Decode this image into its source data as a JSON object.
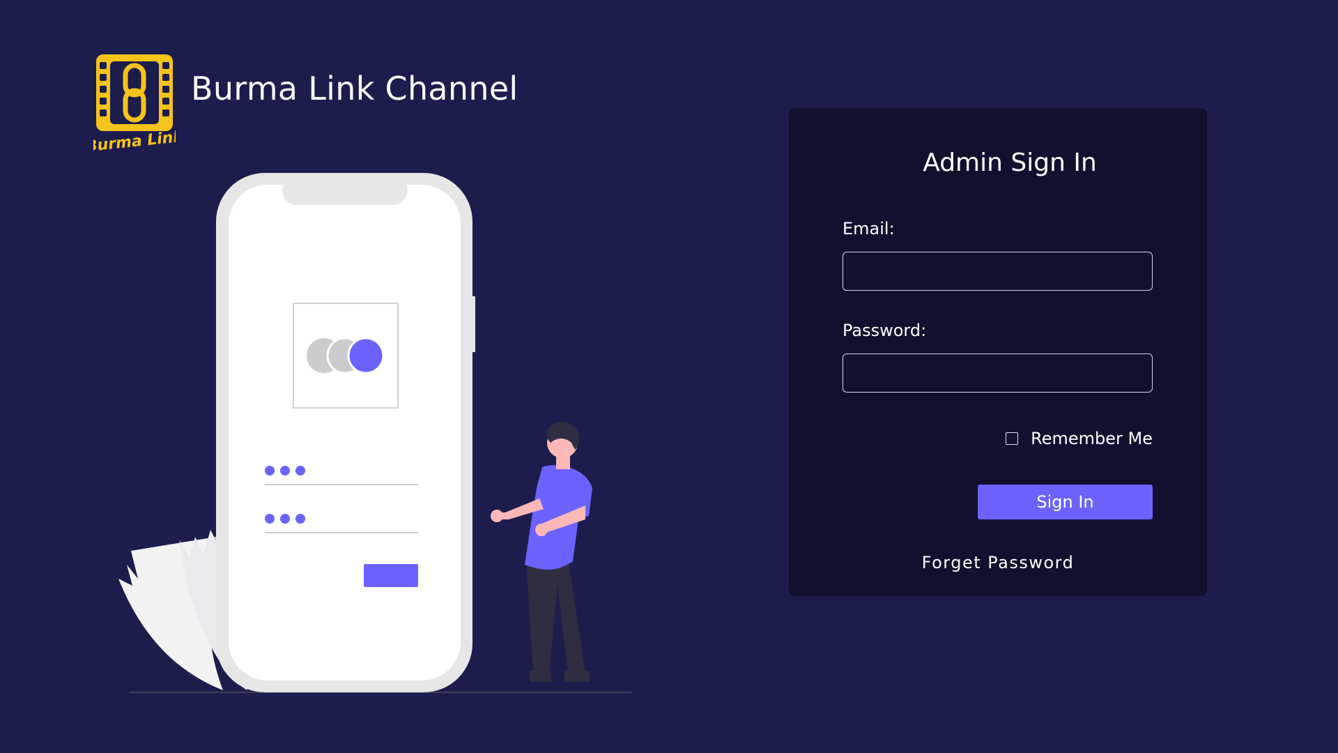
{
  "brand": {
    "logo_text": "Burma Link",
    "title": "Burma Link Channel"
  },
  "colors": {
    "background": "#1c1d4d",
    "card": "#11112f",
    "accent": "#6c63ff",
    "logo_yellow": "#f6c31b"
  },
  "illustration": {
    "icons": [
      "phone-illustration",
      "person-illustration",
      "leaf-illustration"
    ]
  },
  "signin": {
    "title": "Admin Sign In",
    "email_label": "Email:",
    "email_value": "",
    "password_label": "Password:",
    "password_value": "",
    "remember_label": "Remember Me",
    "remember_checked": false,
    "submit_label": "Sign In",
    "forgot_label": "Forget Password"
  }
}
